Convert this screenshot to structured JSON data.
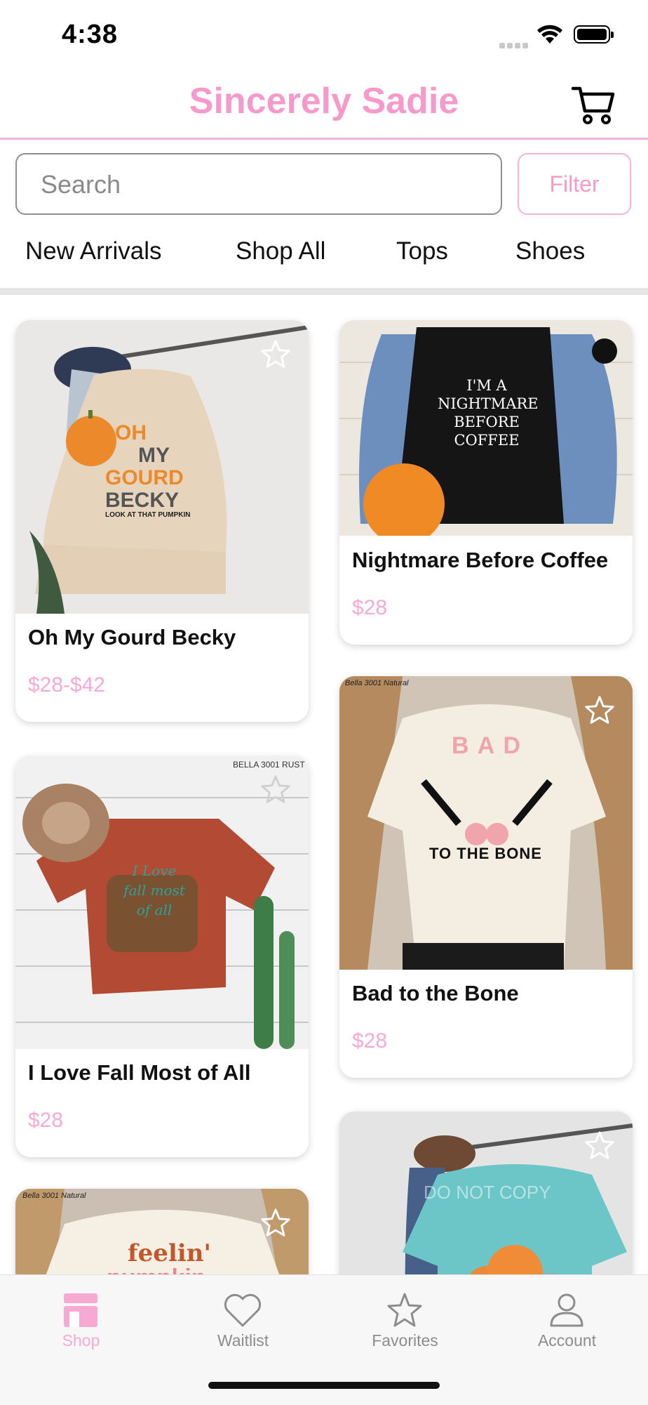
{
  "status_bar": {
    "time": "4:38"
  },
  "header": {
    "brand": "Sincerely Sadie",
    "cart_icon": "cart-icon"
  },
  "search": {
    "placeholder": "Search",
    "value": "",
    "filter_label": "Filter"
  },
  "categories": [
    "New Arrivals",
    "Shop All",
    "Tops",
    "Shoes"
  ],
  "products": [
    {
      "title": "Oh My Gourd Becky",
      "price": "$28-$42",
      "image_text": [
        "OH",
        "MY",
        "GOURD",
        "BECKY",
        "LOOK AT THAT PUMPKIN"
      ],
      "shirt_color": "#e9d7c1"
    },
    {
      "title": "Nightmare Before Coffee",
      "price": "$28",
      "image_text": [
        "I'M A",
        "NIGHTMARE",
        "BEFORE",
        "COFFEE"
      ],
      "shirt_color": "#111111"
    },
    {
      "title": "I Love Fall Most of All",
      "price": "$28",
      "image_text": [
        "BELLA 3001 RUST",
        "I Love",
        "fall most",
        "of all"
      ],
      "shirt_color": "#b34a33"
    },
    {
      "title": "Bad to the Bone",
      "price": "$28",
      "image_text": [
        "Bella 3001 Natural",
        "B A D",
        "TO THE BONE"
      ],
      "shirt_color": "#f3ede2"
    },
    {
      "title": "",
      "price": "",
      "image_text": [
        "Bella 3001 Natural",
        "feelin'",
        "pumpkin"
      ],
      "shirt_color": "#f6efe4"
    },
    {
      "title": "",
      "price": "",
      "image_text": [
        "DO NOT COPY"
      ],
      "shirt_color": "#6cc6c8"
    }
  ],
  "tab_bar": [
    {
      "label": "Shop",
      "icon": "storefront-icon",
      "active": true
    },
    {
      "label": "Waitlist",
      "icon": "heart-icon",
      "active": false
    },
    {
      "label": "Favorites",
      "icon": "star-icon",
      "active": false
    },
    {
      "label": "Account",
      "icon": "person-icon",
      "active": false
    }
  ],
  "colors": {
    "brand_pink": "#f59acb",
    "price_pink": "#f6a9d3",
    "border_pink": "#f5b3d9",
    "tab_inactive": "#8d8d8d"
  }
}
